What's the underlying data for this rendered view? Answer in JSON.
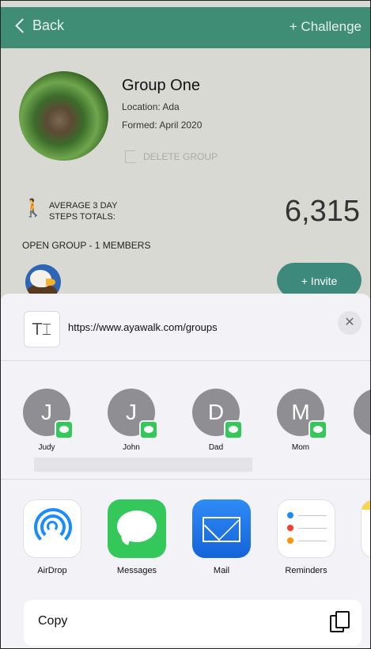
{
  "nav": {
    "back_label": "Back",
    "challenge_label": "+ Challenge"
  },
  "group": {
    "name": "Group One",
    "location": "Location: Ada",
    "formed": "Formed: April 2020",
    "delete_label": "DELETE GROUP",
    "avg_label": "AVERAGE 3 DAY\nSTEPS TOTALS:",
    "avg_value": "6,315",
    "members_label": "OPEN GROUP - 1 MEMBERS",
    "invite_label": "+ Invite"
  },
  "share": {
    "text_icon": "T⌶",
    "url": "https://www.ayawalk.com/groups",
    "close_label": "✕",
    "people": [
      {
        "initial": "J",
        "name": "Judy"
      },
      {
        "initial": "J",
        "name": "John"
      },
      {
        "initial": "D",
        "name": "Dad"
      },
      {
        "initial": "M",
        "name": "Mom"
      }
    ],
    "apps": [
      {
        "name": "AirDrop",
        "icon": "airdrop-icon"
      },
      {
        "name": "Messages",
        "icon": "messages-icon"
      },
      {
        "name": "Mail",
        "icon": "mail-icon"
      },
      {
        "name": "Reminders",
        "icon": "reminders-icon"
      }
    ],
    "copy_label": "Copy"
  },
  "colors": {
    "header": "#3f8d75",
    "invite": "#3d8a7c",
    "badge": "#34c759",
    "contact": "#8e8e93"
  }
}
